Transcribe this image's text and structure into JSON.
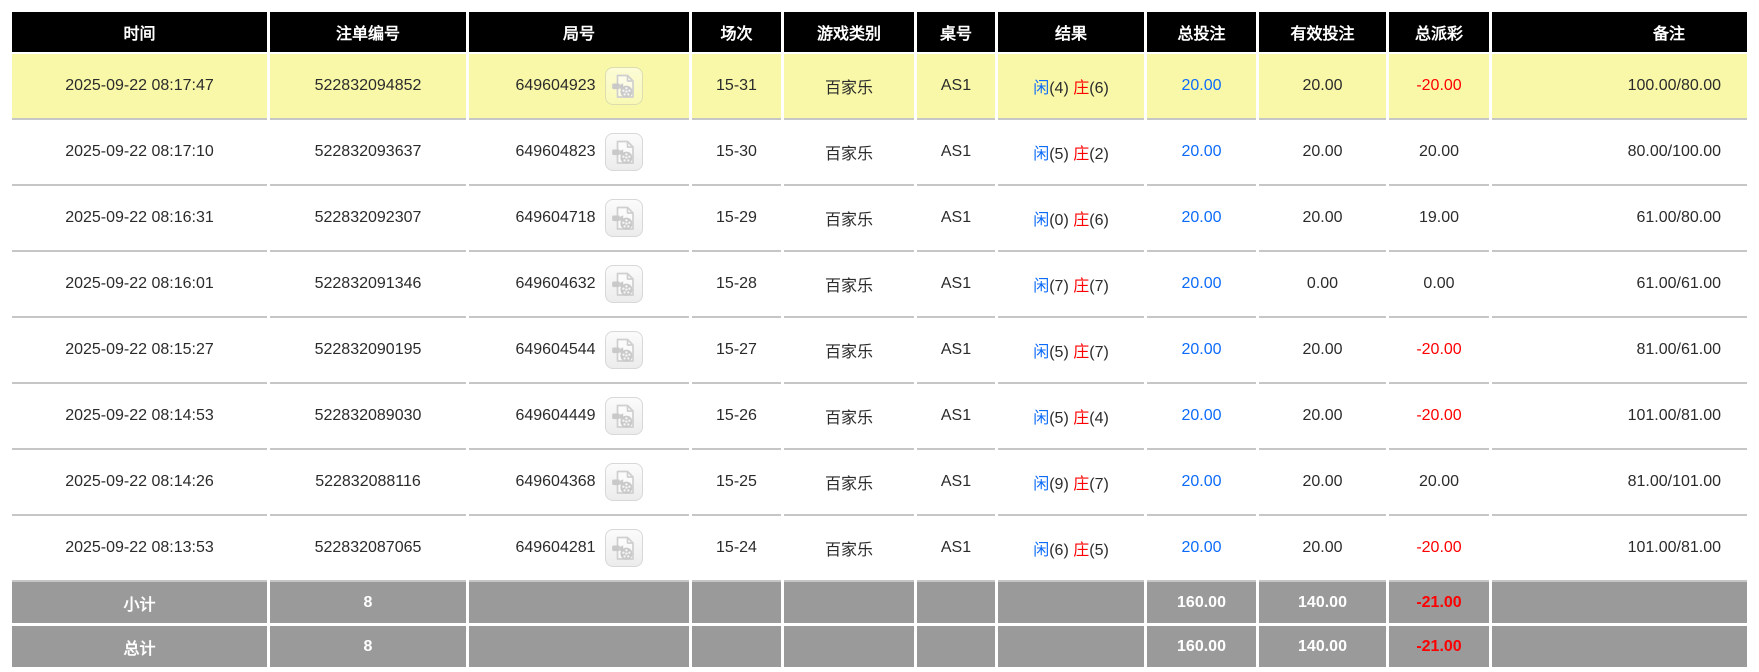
{
  "colors": {
    "header_bg": "#000000",
    "header_text": "#ffffff",
    "highlight_row_bg": "#f8f8a8",
    "summary_row_bg": "#9a9a9a",
    "summary_text": "#ffffff",
    "accent_blue": "#0d6bfa",
    "negative_red": "#ff0000",
    "row_border": "#c6c6c6",
    "body_text": "#2b2b2b"
  },
  "table": {
    "columns": [
      {
        "key": "time",
        "label": "时间"
      },
      {
        "key": "bet_id",
        "label": "注单编号"
      },
      {
        "key": "round",
        "label": "局号"
      },
      {
        "key": "session",
        "label": "场次"
      },
      {
        "key": "game_type",
        "label": "游戏类别"
      },
      {
        "key": "table_no",
        "label": "桌号"
      },
      {
        "key": "result",
        "label": "结果"
      },
      {
        "key": "total_bet",
        "label": "总投注"
      },
      {
        "key": "valid_bet",
        "label": "有效投注"
      },
      {
        "key": "payout",
        "label": "总派彩"
      },
      {
        "key": "remark",
        "label": "备注"
      }
    ],
    "rows": [
      {
        "highlighted": true,
        "time": "2025-09-22 08:17:47",
        "bet_id": "522832094852",
        "round": "649604923",
        "session": "15-31",
        "game_type": "百家乐",
        "table_no": "AS1",
        "result": [
          {
            "text": "闲",
            "color": "blue"
          },
          {
            "text": "(4) ",
            "color": "dark"
          },
          {
            "text": "庄",
            "color": "red"
          },
          {
            "text": "(6)",
            "color": "dark"
          }
        ],
        "total_bet": "20.00",
        "valid_bet": "20.00",
        "payout": "-20.00",
        "remark": "100.00/80.00"
      },
      {
        "highlighted": false,
        "time": "2025-09-22 08:17:10",
        "bet_id": "522832093637",
        "round": "649604823",
        "session": "15-30",
        "game_type": "百家乐",
        "table_no": "AS1",
        "result": [
          {
            "text": "闲",
            "color": "blue"
          },
          {
            "text": "(5) ",
            "color": "dark"
          },
          {
            "text": "庄",
            "color": "red"
          },
          {
            "text": "(2)",
            "color": "dark"
          }
        ],
        "total_bet": "20.00",
        "valid_bet": "20.00",
        "payout": "20.00",
        "remark": "80.00/100.00"
      },
      {
        "highlighted": false,
        "time": "2025-09-22 08:16:31",
        "bet_id": "522832092307",
        "round": "649604718",
        "session": "15-29",
        "game_type": "百家乐",
        "table_no": "AS1",
        "result": [
          {
            "text": "闲",
            "color": "blue"
          },
          {
            "text": "(0) ",
            "color": "dark"
          },
          {
            "text": "庄",
            "color": "red"
          },
          {
            "text": "(6)",
            "color": "dark"
          }
        ],
        "total_bet": "20.00",
        "valid_bet": "20.00",
        "payout": "19.00",
        "remark": "61.00/80.00"
      },
      {
        "highlighted": false,
        "time": "2025-09-22 08:16:01",
        "bet_id": "522832091346",
        "round": "649604632",
        "session": "15-28",
        "game_type": "百家乐",
        "table_no": "AS1",
        "result": [
          {
            "text": "闲",
            "color": "blue"
          },
          {
            "text": "(7) ",
            "color": "dark"
          },
          {
            "text": "庄",
            "color": "red"
          },
          {
            "text": "(7)",
            "color": "dark"
          }
        ],
        "total_bet": "20.00",
        "valid_bet": "0.00",
        "payout": "0.00",
        "remark": "61.00/61.00"
      },
      {
        "highlighted": false,
        "time": "2025-09-22 08:15:27",
        "bet_id": "522832090195",
        "round": "649604544",
        "session": "15-27",
        "game_type": "百家乐",
        "table_no": "AS1",
        "result": [
          {
            "text": "闲",
            "color": "blue"
          },
          {
            "text": "(5) ",
            "color": "dark"
          },
          {
            "text": "庄",
            "color": "red"
          },
          {
            "text": "(7)",
            "color": "dark"
          }
        ],
        "total_bet": "20.00",
        "valid_bet": "20.00",
        "payout": "-20.00",
        "remark": "81.00/61.00"
      },
      {
        "highlighted": false,
        "time": "2025-09-22 08:14:53",
        "bet_id": "522832089030",
        "round": "649604449",
        "session": "15-26",
        "game_type": "百家乐",
        "table_no": "AS1",
        "result": [
          {
            "text": "闲",
            "color": "blue"
          },
          {
            "text": "(5) ",
            "color": "dark"
          },
          {
            "text": "庄",
            "color": "red"
          },
          {
            "text": "(4)",
            "color": "dark"
          }
        ],
        "total_bet": "20.00",
        "valid_bet": "20.00",
        "payout": "-20.00",
        "remark": "101.00/81.00"
      },
      {
        "highlighted": false,
        "time": "2025-09-22 08:14:26",
        "bet_id": "522832088116",
        "round": "649604368",
        "session": "15-25",
        "game_type": "百家乐",
        "table_no": "AS1",
        "result": [
          {
            "text": "闲",
            "color": "blue"
          },
          {
            "text": "(9) ",
            "color": "dark"
          },
          {
            "text": "庄",
            "color": "red"
          },
          {
            "text": "(7)",
            "color": "dark"
          }
        ],
        "total_bet": "20.00",
        "valid_bet": "20.00",
        "payout": "20.00",
        "remark": "81.00/101.00"
      },
      {
        "highlighted": false,
        "time": "2025-09-22 08:13:53",
        "bet_id": "522832087065",
        "round": "649604281",
        "session": "15-24",
        "game_type": "百家乐",
        "table_no": "AS1",
        "result": [
          {
            "text": "闲",
            "color": "blue"
          },
          {
            "text": "(6) ",
            "color": "dark"
          },
          {
            "text": "庄",
            "color": "red"
          },
          {
            "text": "(5)",
            "color": "dark"
          }
        ],
        "total_bet": "20.00",
        "valid_bet": "20.00",
        "payout": "-20.00",
        "remark": "101.00/81.00"
      }
    ],
    "footer_rows": [
      {
        "label": "小计",
        "count": "8",
        "total_bet": "160.00",
        "valid_bet": "140.00",
        "payout": "-21.00"
      },
      {
        "label": "总计",
        "count": "8",
        "total_bet": "160.00",
        "valid_bet": "140.00",
        "payout": "-21.00"
      }
    ]
  }
}
